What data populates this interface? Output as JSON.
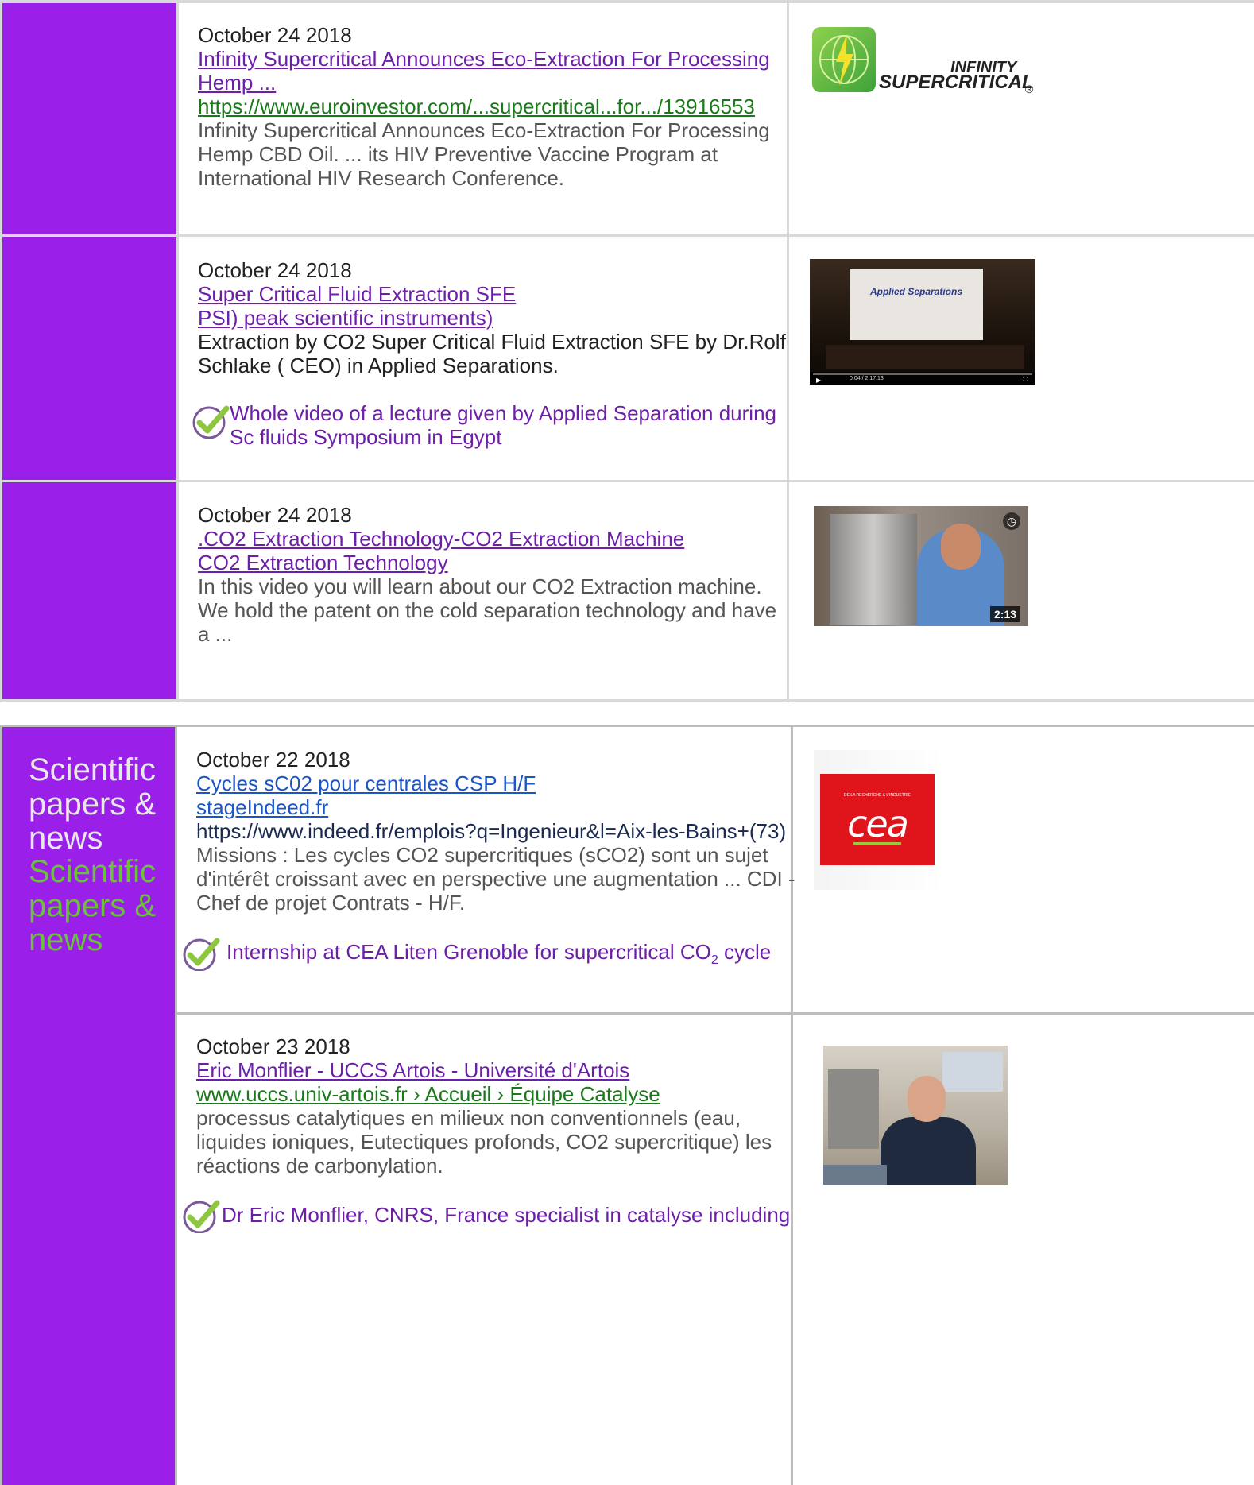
{
  "rows": [
    {
      "date": "October 24 2018",
      "title_line1": "Infinity Supercritical Announces Eco-Extraction For Processing",
      "title_line2": "Hemp ...",
      "url": "https://www.euroinvestor.com/...supercritical...for.../13916553",
      "desc_line1": " Infinity Supercritical Announces Eco-Extraction For Processing",
      "desc_line2": "Hemp CBD Oil. ... its HIV Preventive Vaccine Program at",
      "desc_line3": "International HIV Research Conference.",
      "logo_top": "INFINITY",
      "logo_bottom": "SUPERCRITICAL",
      "logo_reg": "®"
    },
    {
      "date": "October 24 2018",
      "title_line1": "Super Critical Fluid Extraction SFE",
      "title_line2": "PSI) peak scientific instruments)",
      "desc_line1": "Extraction by CO2 Super Critical Fluid Extraction SFE by Dr.Rolf",
      "desc_line2": "Schlake ( CEO) in Applied Separations.",
      "check_line1": " Whole video of a lecture given by Applied Separation during",
      "check_line2": "Sc fluids Symposium in Egypt",
      "screen_text": "Applied Separations",
      "video_time": "0:04 / 2:17:13"
    },
    {
      "date": "October 24 2018",
      "title_line1": ".CO2 Extraction Technology-CO2 Extraction Machine",
      "title_line2": "CO2 Extraction Technology",
      "desc_line1": "In this video you will learn about our CO2 Extraction machine.",
      "desc_line2": "We hold the patent on the cold separation technology and have",
      "desc_line3": "a ...",
      "video_duration": "2:13"
    },
    {
      "date": "October 22 2018",
      "title_line1": "Cycles sC02 pour centrales CSP H/F",
      "title_line2": "stageIndeed.fr",
      "url": "https://www.indeed.fr/emplois?q=Ingenieur&l=Aix-les-Bains+(73)",
      "desc_line1": " Missions : Les cycles CO2 supercritiques (sCO2) sont un sujet",
      "desc_line2": "d'intérêt croissant avec en perspective une augmentation ... CDI -",
      "desc_line3": "Chef de projet Contrats - H/F.",
      "check_line1_a": " Internship at CEA Liten Grenoble for supercritical CO",
      "check_sub": "2",
      "check_line1_b": " cycle",
      "logo_small": "DE LA RECHERCHE À L'INDUSTRIE",
      "logo_main": "cea"
    },
    {
      "date": "October 23 2018",
      "title_line1": "Eric Monflier - UCCS Artois - Université d'Artois",
      "url": "www.uccs.univ-artois.fr › Accueil › Équipe Catalyse",
      "desc_line1": " processus catalytiques en milieux non conventionnels (eau,",
      "desc_line2": "liquides ioniques, Eutectiques profonds, CO2 supercritique) les",
      "desc_line3": "réactions de carbonylation.",
      "check_line1": " Dr Eric Monflier, CNRS, France specialist in catalyse including"
    }
  ],
  "side_label_white": [
    "Scientific",
    "papers &",
    "news"
  ],
  "side_label_green": [
    "Scientific",
    "papers &",
    "news"
  ],
  "colors": {
    "purple": "#9a1fe8",
    "link_purple": "#6c1fa8",
    "link_green": "#1a7a1a",
    "check_green": "#8dc63f"
  }
}
